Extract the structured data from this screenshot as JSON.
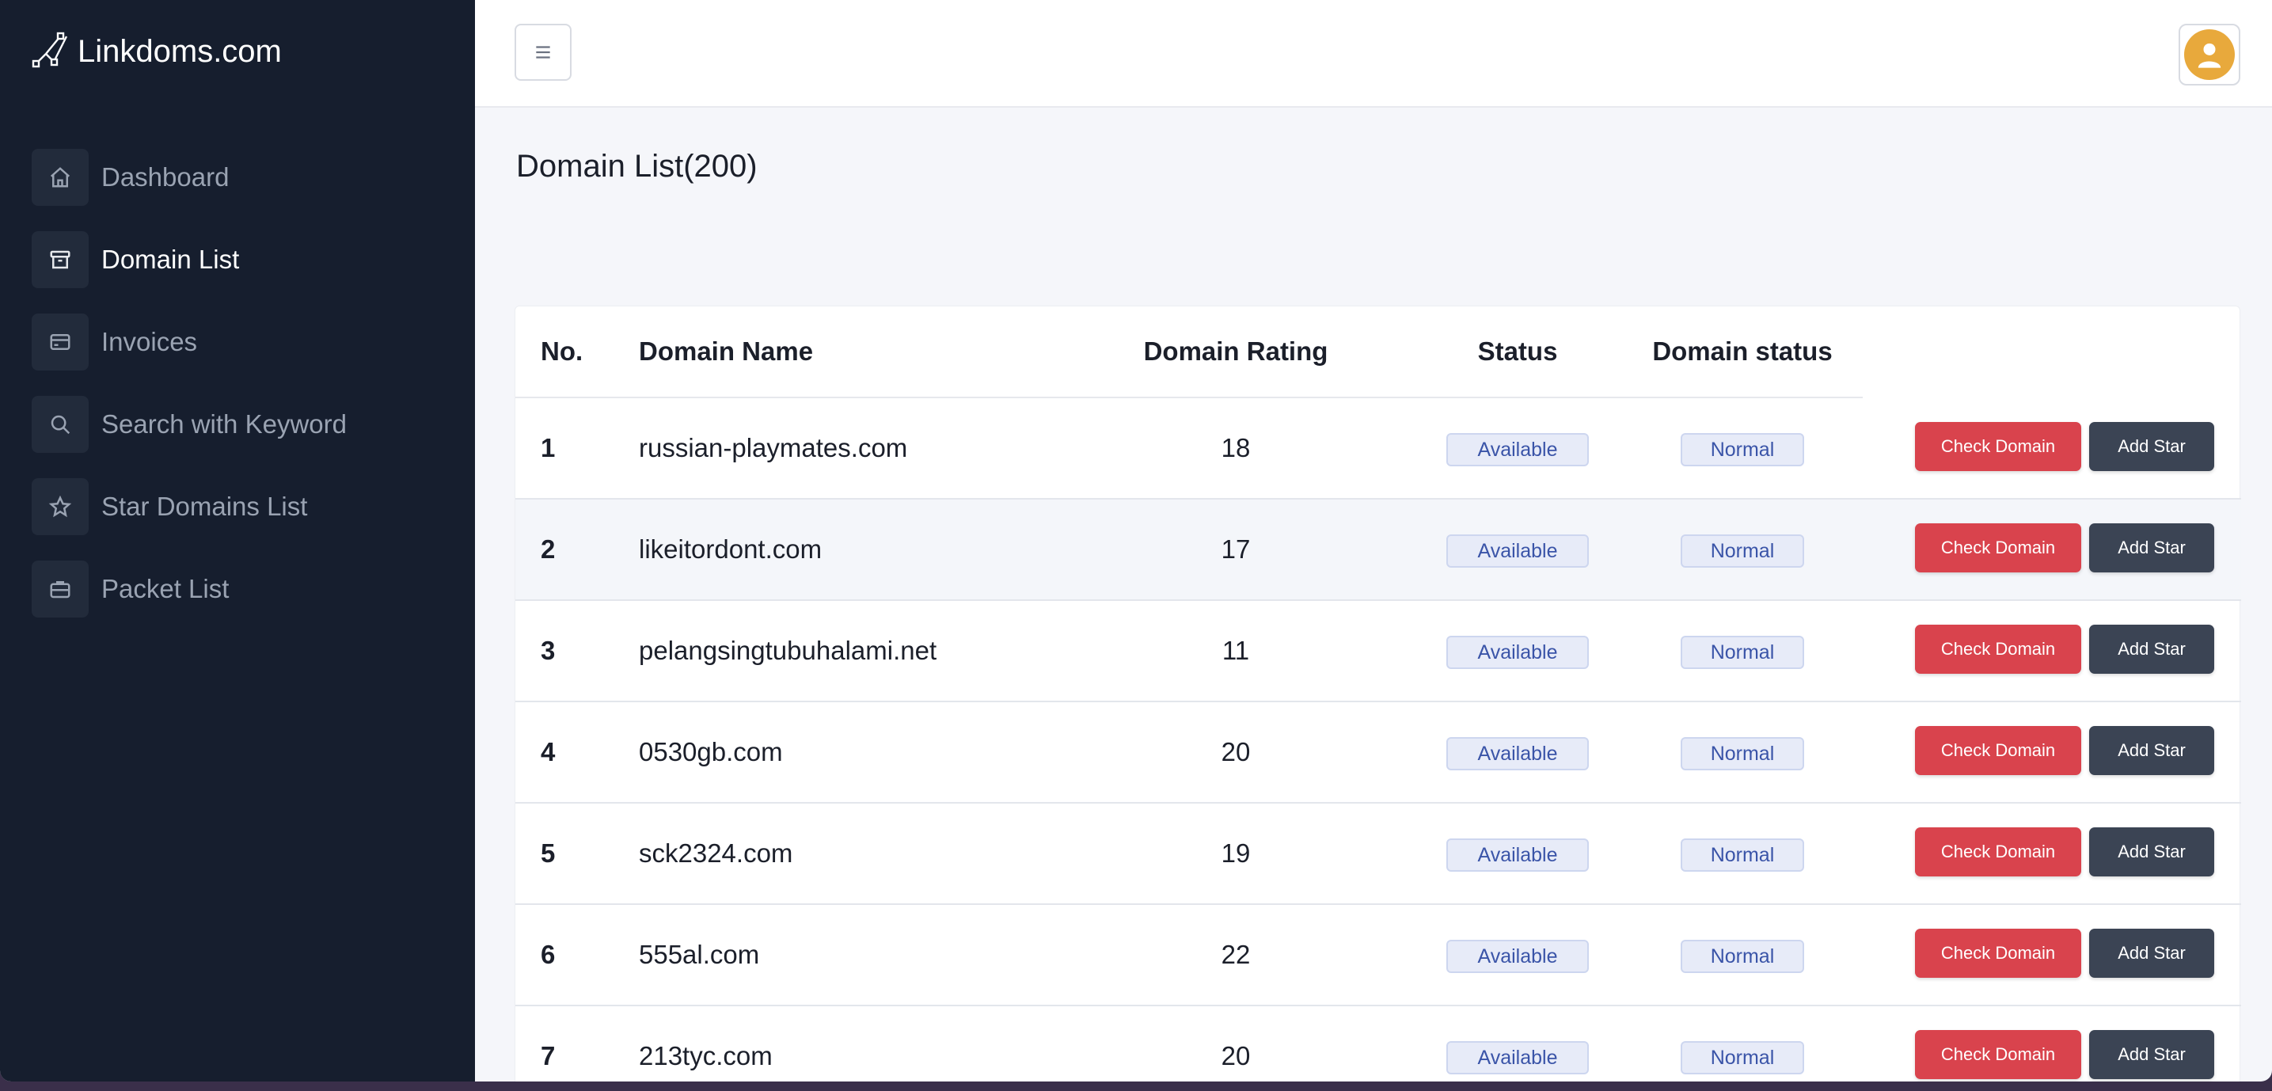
{
  "brand": {
    "name": "Linkdoms.com"
  },
  "sidebar": {
    "items": [
      {
        "label": "Dashboard",
        "icon": "home-icon",
        "active": false
      },
      {
        "label": "Domain List",
        "icon": "archive-icon",
        "active": true
      },
      {
        "label": "Invoices",
        "icon": "credit-card-icon",
        "active": false
      },
      {
        "label": "Search with Keyword",
        "icon": "search-icon",
        "active": false
      },
      {
        "label": "Star Domains List",
        "icon": "star-icon",
        "active": false
      },
      {
        "label": "Packet List",
        "icon": "briefcase-icon",
        "active": false
      }
    ]
  },
  "topbar": {
    "menu_icon": "hamburger-icon",
    "avatar_icon": "user-avatar-icon",
    "avatar_color": "#e8a93c"
  },
  "page": {
    "title": "Domain List(200)"
  },
  "table": {
    "headers": {
      "no": "No.",
      "name": "Domain Name",
      "rating": "Domain Rating",
      "status": "Status",
      "domain_status": "Domain status"
    },
    "rows": [
      {
        "no": "1",
        "name": "russian-playmates.com",
        "rating": "18",
        "status": "Available",
        "domain_status": "Normal",
        "check": "Check Domain",
        "star": "Add Star"
      },
      {
        "no": "2",
        "name": "likeitordont.com",
        "rating": "17",
        "status": "Available",
        "domain_status": "Normal",
        "check": "Check Domain",
        "star": "Add Star"
      },
      {
        "no": "3",
        "name": "pelangsingtubuhalami.net",
        "rating": "11",
        "status": "Available",
        "domain_status": "Normal",
        "check": "Check Domain",
        "star": "Add Star"
      },
      {
        "no": "4",
        "name": "0530gb.com",
        "rating": "20",
        "status": "Available",
        "domain_status": "Normal",
        "check": "Check Domain",
        "star": "Add Star"
      },
      {
        "no": "5",
        "name": "sck2324.com",
        "rating": "19",
        "status": "Available",
        "domain_status": "Normal",
        "check": "Check Domain",
        "star": "Add Star"
      },
      {
        "no": "6",
        "name": "555al.com",
        "rating": "22",
        "status": "Available",
        "domain_status": "Normal",
        "check": "Check Domain",
        "star": "Add Star"
      },
      {
        "no": "7",
        "name": "213tyc.com",
        "rating": "20",
        "status": "Available",
        "domain_status": "Normal",
        "check": "Check Domain",
        "star": "Add Star"
      }
    ]
  },
  "colors": {
    "sidebar_bg": "#161e2e",
    "check_button": "#d9434d",
    "star_button": "#3b4454",
    "badge_text": "#3a54a8"
  }
}
